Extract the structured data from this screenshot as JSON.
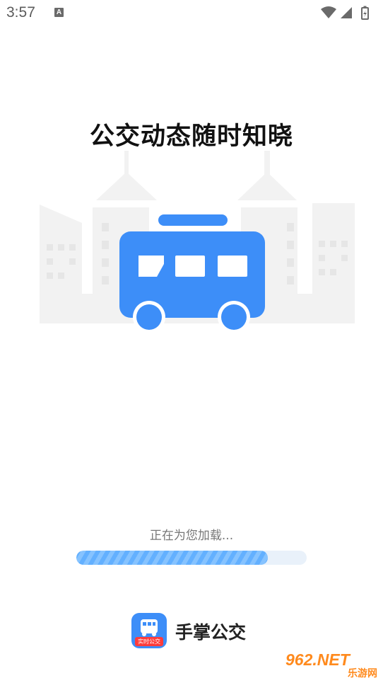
{
  "status_bar": {
    "time": "3:57",
    "notification_badge": "A",
    "icons": [
      "wifi-icon",
      "cell-signal-icon",
      "battery-icon"
    ]
  },
  "headline": "公交动态随时知晓",
  "loading": {
    "text": "正在为您加载...",
    "progress": 0.83
  },
  "brand": {
    "app_name": "手掌公交",
    "icon_tag": "实时公交"
  },
  "watermark": {
    "top": "962.NET",
    "bottom": "乐游网"
  },
  "colors": {
    "bus_blue": "#3d8ef8",
    "skyline_gray": "#f2f2f2",
    "progress_fill": "#63b0ff",
    "progress_track": "#e9f1fa"
  }
}
